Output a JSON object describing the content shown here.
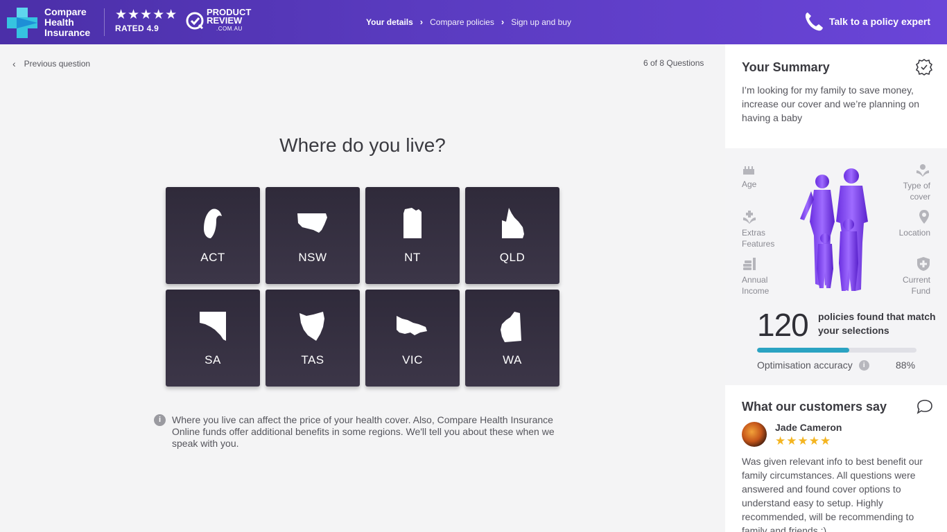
{
  "header": {
    "brand_line1": "Compare",
    "brand_line2": "Health",
    "brand_line3": "Insurance",
    "stars": "★★★★★",
    "rated": "RATED 4.9",
    "pr_line1": "PRODUCT",
    "pr_line2": "REVIEW",
    "pr_line3": ".COM.AU",
    "steps": [
      "Your details",
      "Compare policies",
      "Sign up and buy"
    ],
    "talk": "Talk to a policy expert",
    "brand_color": "#5a3bc0"
  },
  "nav": {
    "previous": "Previous question",
    "counter": "6 of 8 Questions"
  },
  "question": {
    "title": "Where do you live?",
    "options": [
      "ACT",
      "NSW",
      "NT",
      "QLD",
      "SA",
      "TAS",
      "VIC",
      "WA"
    ],
    "note": "Where you live can affect the price of your health cover. Also, Compare Health Insurance Online funds offer additional benefits in some regions. We'll tell you about these when we speak with you."
  },
  "summary": {
    "title": "Your Summary",
    "description": "I’m looking for my family to save money, increase our cover and we’re planning on having a baby",
    "attributes": {
      "age": "Age",
      "type_of_cover_1": "Type of",
      "type_of_cover_2": "cover",
      "extras_1": "Extras",
      "extras_2": "Features",
      "location": "Location",
      "income_1": "Annual",
      "income_2": "Income",
      "fund_1": "Current",
      "fund_2": "Fund"
    },
    "count": "120",
    "count_label": "policies found that match your selections",
    "accuracy_label": "Optimisation accuracy",
    "accuracy_value": "88%",
    "progress_fraction": 0.58,
    "progress_color": "#2ba3c2"
  },
  "reviews": {
    "title": "What our customers say",
    "name": "Jade Cameron",
    "stars": "★★★★★",
    "text": "Was given relevant info to best benefit our family circumstances. All questions were answered and found cover options to understand easy to setup. Highly recommended, will be recommending to family and friends :)"
  }
}
